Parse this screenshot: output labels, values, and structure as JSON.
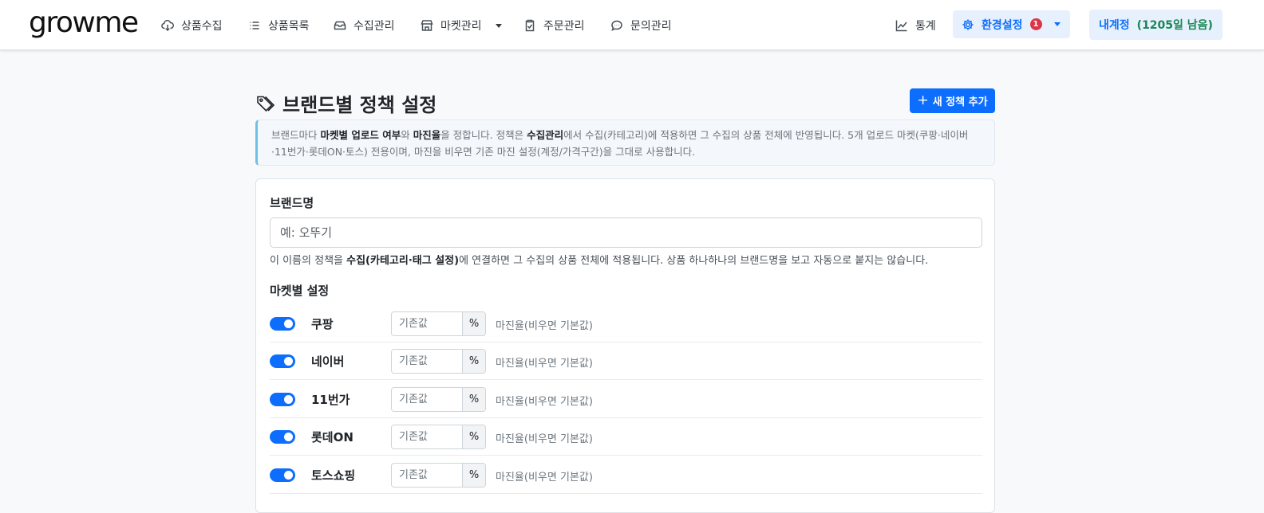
{
  "nav": {
    "logo": "growme",
    "items": [
      {
        "label": "상품수집",
        "icon": "cloud-download-icon"
      },
      {
        "label": "상품목록",
        "icon": "list-icon"
      },
      {
        "label": "수집관리",
        "icon": "tray-icon"
      },
      {
        "label": "마켓관리",
        "icon": "shop-icon"
      },
      {
        "label": "주문관리",
        "icon": "clipboard-check-icon"
      },
      {
        "label": "문의관리",
        "icon": "chat-icon"
      }
    ],
    "stats_label": "통계",
    "settings_label": "환경설정",
    "settings_badge": "1",
    "account_name": "내계정",
    "account_remaining": "(1205일 남음)"
  },
  "page": {
    "title": "브랜드별 정책 설정",
    "add_button": "새 정책 추가"
  },
  "info": {
    "t1": "브랜드마다 ",
    "b1": "마켓별 업로드 여부",
    "t2": "와 ",
    "b2": "마진율",
    "t3": "을 정합니다. 정책은 ",
    "b3": "수집관리",
    "t4": "에서 수집(카테고리)에 적용하면 그 수집의 상품 전체에 반영됩니다. 5개 업로드 마켓(쿠팡·네이버·11번가·롯데ON·토스) 전용이며, 마진을 비우면 기존 마진 설정(계정/가격구간)을 그대로 사용합니다."
  },
  "form": {
    "brand_label": "브랜드명",
    "brand_placeholder": "예: 오뚜기",
    "help_t1": "이 이름의 정책을 ",
    "help_b1": "수집(카테고리·태그 설정)",
    "help_t2": "에 연결하면 그 수집의 상품 전체에 적용됩니다. 상품 하나하나의 브랜드명을 보고 자동으로 붙지는 않습니다.",
    "market_section_label": "마켓별 설정",
    "margin_placeholder": "기존값",
    "pct": "%",
    "margin_hint": "마진율(비우면 기본값)",
    "markets": [
      {
        "name": "쿠팡",
        "enabled": true
      },
      {
        "name": "네이버",
        "enabled": true
      },
      {
        "name": "11번가",
        "enabled": true
      },
      {
        "name": "롯데ON",
        "enabled": true
      },
      {
        "name": "토스쇼핑",
        "enabled": true
      }
    ]
  },
  "colors": {
    "primary": "#0d6efd",
    "success": "#198754",
    "danger": "#dc3545"
  }
}
